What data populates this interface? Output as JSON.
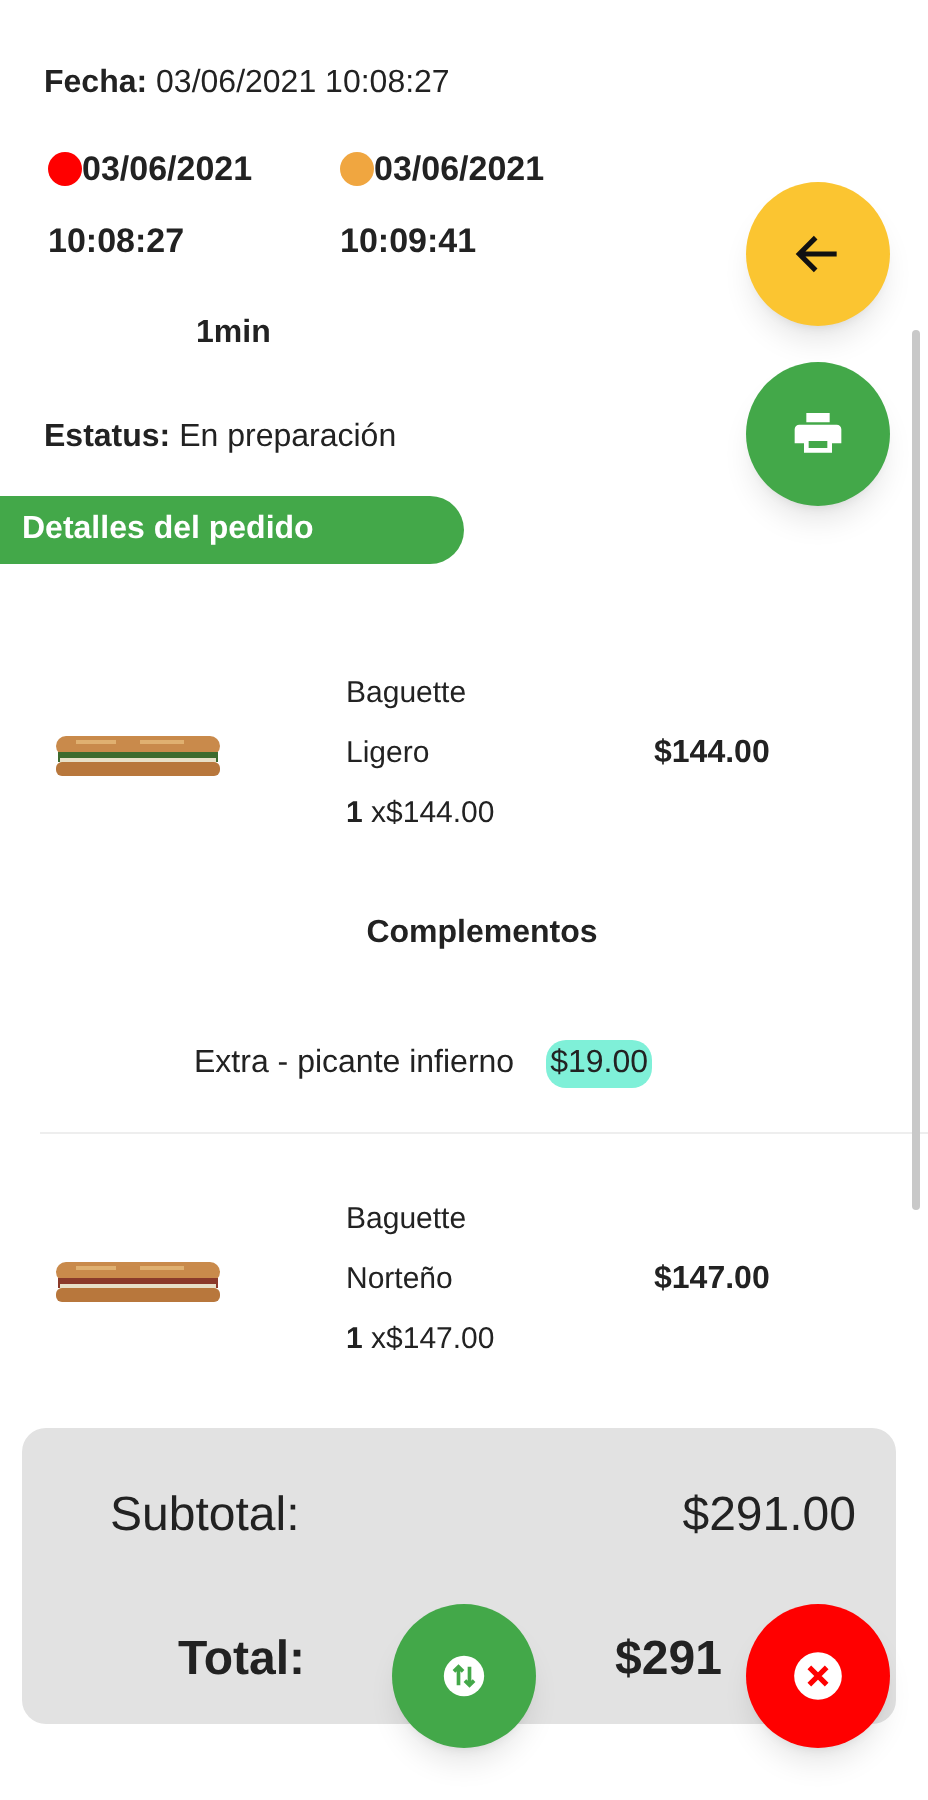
{
  "order": {
    "date_label": "Fecha:",
    "date": "03/06/2021 10:08:27",
    "timestamps": [
      {
        "date": "03/06/2021",
        "time": "10:08:27",
        "color": "#ff0000"
      },
      {
        "date": "03/06/2021",
        "time": "10:09:41",
        "color": "#f0a640"
      }
    ],
    "duration": "1min",
    "status_label": "Estatus:",
    "status": "En preparación"
  },
  "details_header": "Detalles del pedido",
  "items": [
    {
      "name": "Baguette",
      "variant": "Ligero",
      "qty": "1",
      "unit_price": "x$144.00",
      "price": "$144.00",
      "complements_title": "Complementos",
      "complements": [
        {
          "name": "Extra - picante infierno",
          "price": "$19.00"
        }
      ]
    },
    {
      "name": "Baguette",
      "variant": "Norteño",
      "qty": "1",
      "unit_price": "x$147.00",
      "price": "$147.00"
    }
  ],
  "summary": {
    "subtotal_label": "Subtotal:",
    "subtotal": "$291.00",
    "total_label": "Total:",
    "total": "$291"
  }
}
